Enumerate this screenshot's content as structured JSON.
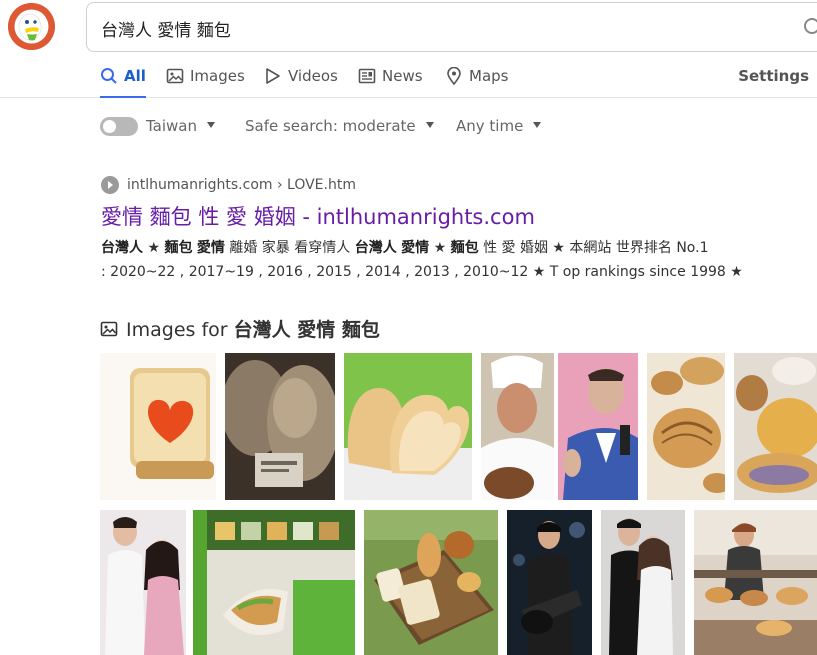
{
  "search": {
    "query": "台灣人 愛情 麵包"
  },
  "tabs": [
    {
      "label": "All",
      "icon": "search-icon",
      "active": true
    },
    {
      "label": "Images",
      "icon": "image-icon"
    },
    {
      "label": "Videos",
      "icon": "play-icon"
    },
    {
      "label": "News",
      "icon": "news-icon"
    },
    {
      "label": "Maps",
      "icon": "map-pin-icon"
    }
  ],
  "settings_label": "Settings",
  "filters": {
    "region": "Taiwan",
    "safe_search": "Safe search: moderate",
    "time": "Any time"
  },
  "result": {
    "domain": "intlhumanrights.com",
    "path": " › LOVE.htm",
    "title": "愛情 麵包 性 愛 婚姻 - intlhumanrights.com",
    "snippet_line1_parts": [
      "台灣人",
      " ★ ",
      "麵包",
      " ",
      "愛情",
      " 離婚 家暴 看穿情人 ",
      "台灣人",
      " ",
      "愛情",
      " ★ ",
      "麵包",
      " 性 愛 婚姻 ★ 本網站 世界排名 No.1"
    ],
    "snippet_line2": ": 2020~22 , 2017~19 , 2016 , 2015 , 2014 , 2013 , 2010~12 ★ T op rankings since 1998 ★"
  },
  "images_section": {
    "prefix": "Images for ",
    "query": "台灣人 愛情 麵包"
  },
  "colors": {
    "accent": "#3969ef",
    "visited_link": "#681da8",
    "logo": "#de5833"
  }
}
